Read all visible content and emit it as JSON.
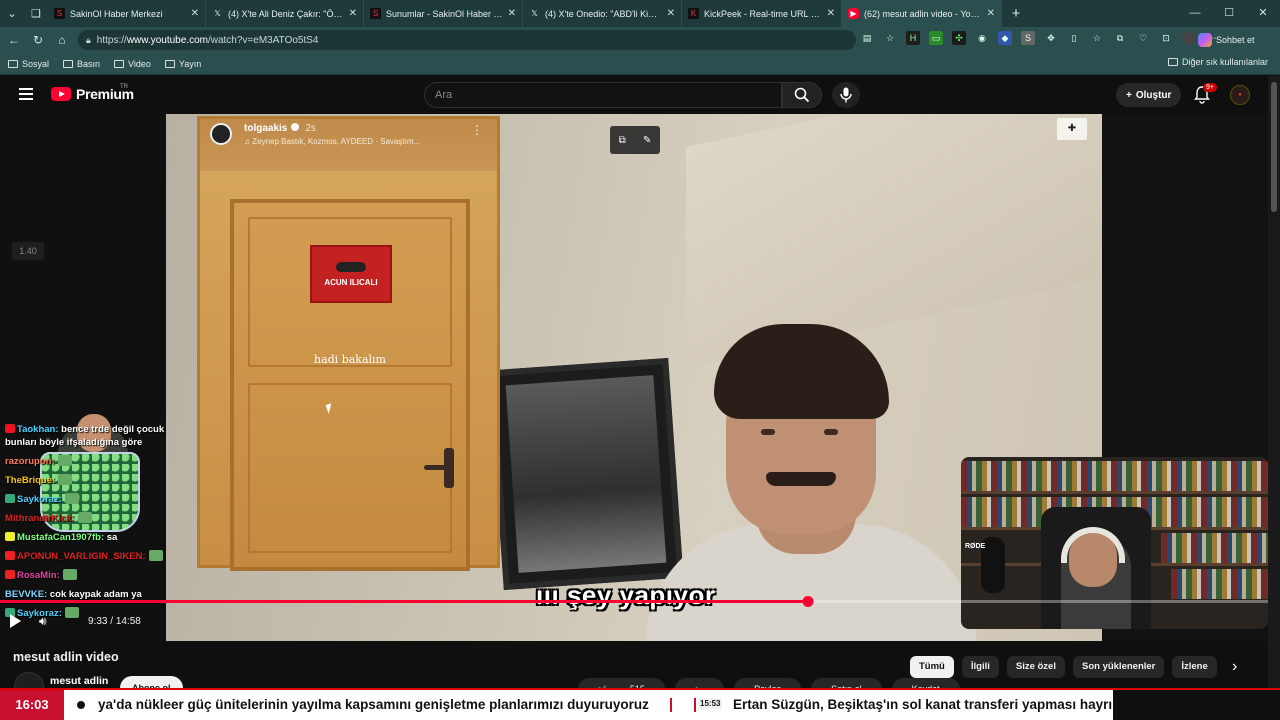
{
  "browser": {
    "tabs": [
      {
        "title": "SakinOl Haber Merkezi",
        "favicon": "sakinol",
        "active": false
      },
      {
        "title": "(4) X'te Ali Deniz Çakır: \"Öcalan, Ö",
        "favicon": "x",
        "active": false
      },
      {
        "title": "Sunumlar - SakinOl Haber Merkezi",
        "favicon": "sakinol",
        "active": false
      },
      {
        "title": "(4) X'te Onedio: \"ABD'li Kick yayın",
        "favicon": "x",
        "active": false
      },
      {
        "title": "KickPeek - Real-time URL Crawler",
        "favicon": "kickpeek",
        "active": false
      },
      {
        "title": "(62) mesut adlin video - YouTube",
        "favicon": "youtube",
        "active": true
      }
    ],
    "url_scheme": "https://",
    "url_host": "www.youtube.com",
    "url_path": "/watch?v=eM3ATOo5tS4",
    "chat_label": "Sohbet et",
    "bookmarks": [
      "Sosyal",
      "Basın",
      "Video",
      "Yayın"
    ],
    "other_bookmarks": "Diğer sık kullanılanlar"
  },
  "youtube": {
    "brand": "Premium",
    "region": "TR",
    "search_placeholder": "Ara",
    "create_label": "Oluştur",
    "notif_badge": "9+",
    "video_title": "mesut adlin video",
    "channel_name": "mesut adlin",
    "subscribe_label": "Abone ol",
    "actions": [
      "515",
      "Paylaş",
      "Satın al",
      "Kaydet"
    ],
    "chips": [
      {
        "label": "Tümü",
        "active": true
      },
      {
        "label": "İlgili",
        "active": false
      },
      {
        "label": "Size özel",
        "active": false
      },
      {
        "label": "Son yüklenenler",
        "active": false
      },
      {
        "label": "İzlene",
        "active": false
      }
    ]
  },
  "player": {
    "current_time": "9:33",
    "duration": "14:58",
    "progress": 0.637,
    "left_timestamp": "1.40",
    "subtitle": "ııı şey yapıyor",
    "ig_user": "tolgaakis",
    "ig_time": "2s",
    "ig_music": "Zeynep Bastık, Kozmos, AYDEED · Savaştım...",
    "door_sign": "ACUN ILICALI",
    "door_caption": "hadi bakalım",
    "cam_mic_label": "RØDE"
  },
  "chat": [
    {
      "user": "Taokhan:",
      "msg": "bence trde değil çocuk bunları böyle ifşaladığına göre",
      "color": "#4fd1ff",
      "icon": "#e12"
    },
    {
      "user": "razorupon:",
      "msg": "",
      "color": "#ff7a59",
      "icon": ""
    },
    {
      "user": "TheBrique:",
      "msg": "",
      "color": "#f5c518",
      "icon": ""
    },
    {
      "user": "Saykoraz:",
      "msg": "",
      "color": "#4fd1ff",
      "icon": "#3a7"
    },
    {
      "user": "MithrandirKick:",
      "msg": "",
      "color": "#e02020",
      "icon": ""
    },
    {
      "user": "MustafaCan1907fb:",
      "msg": "sa",
      "color": "#7fff7f",
      "icon": "#ee3"
    },
    {
      "user": "APONUN_VARLIGIN_SIKEN:",
      "msg": "",
      "color": "#e02020",
      "icon": "#e22"
    },
    {
      "user": "RosaMin:",
      "msg": "",
      "color": "#e040a0",
      "icon": "#e22"
    },
    {
      "user": "BEVVKE:",
      "msg": "cok kaypak adam ya",
      "color": "#7fd7ff",
      "icon": ""
    },
    {
      "user": "Saykoraz:",
      "msg": "",
      "color": "#4fd1ff",
      "icon": "#3a7"
    }
  ],
  "ticker": {
    "time": "16:03",
    "text1": "ya'da nükleer güç ünitelerinin yayılma kapsamını genişletme planlarımızı duyuruyoruz",
    "time2": "15:53",
    "text2": "Ertan Süzgün, Beşiktaş'ın sol kanat transferi yapması hayrı"
  }
}
